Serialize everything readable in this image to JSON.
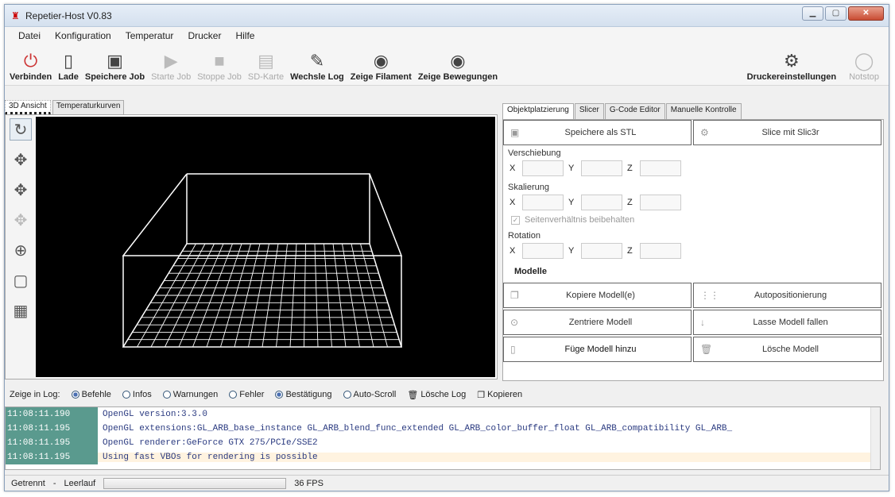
{
  "window": {
    "title": "Repetier-Host V0.83"
  },
  "menu": [
    "Datei",
    "Konfiguration",
    "Temperatur",
    "Drucker",
    "Hilfe"
  ],
  "toolbar": {
    "connect": "Verbinden",
    "load": "Lade",
    "save_job": "Speichere Job",
    "start_job": "Starte Job",
    "stop_job": "Stoppe Job",
    "sd_card": "SD-Karte",
    "toggle_log": "Wechsle Log",
    "show_filament": "Zeige Filament",
    "show_moves": "Zeige Bewegungen",
    "printer_settings": "Druckereinstellungen",
    "emergency_stop": "Notstop"
  },
  "left_tabs": [
    "3D Ansicht",
    "Temperaturkurven"
  ],
  "right_tabs": [
    "Objektplatzierung",
    "Slicer",
    "G-Code Editor",
    "Manuelle Kontrolle"
  ],
  "placement": {
    "save_stl": "Speichere als STL",
    "slice": "Slice mit Slic3r",
    "translation": "Verschiebung",
    "scale": "Skalierung",
    "keep_ratio": "Seitenverhältnis beibehalten",
    "rotation": "Rotation",
    "x": "X",
    "y": "Y",
    "z": "Z",
    "models": "Modelle",
    "copy_model": "Kopiere Modell(e)",
    "autoposition": "Autopositionierung",
    "center_model": "Zentriere Modell",
    "drop_model": "Lasse Modell fallen",
    "add_model": "Füge Modell hinzu",
    "delete_model": "Lösche Modell"
  },
  "log": {
    "show_in_log": "Zeige in Log:",
    "filters": [
      {
        "label": "Befehle",
        "on": true
      },
      {
        "label": "Infos",
        "on": false
      },
      {
        "label": "Warnungen",
        "on": false
      },
      {
        "label": "Fehler",
        "on": false
      },
      {
        "label": "Bestätigung",
        "on": true
      },
      {
        "label": "Auto-Scroll",
        "on": false
      }
    ],
    "clear": "Lösche Log",
    "copy": "Kopieren",
    "lines": [
      {
        "time": "11:08:11.190",
        "text": "OpenGL version:3.3.0"
      },
      {
        "time": "11:08:11.195",
        "text": "OpenGL extensions:GL_ARB_base_instance GL_ARB_blend_func_extended GL_ARB_color_buffer_float GL_ARB_compatibility GL_ARB_"
      },
      {
        "time": "11:08:11.195",
        "text": "OpenGL renderer:GeForce GTX 275/PCIe/SSE2"
      },
      {
        "time": "11:08:11.195",
        "text": "Using fast VBOs for rendering is possible"
      }
    ]
  },
  "status": {
    "connection": "Getrennt",
    "separator": "-",
    "idle": "Leerlauf",
    "fps": "36 FPS"
  }
}
